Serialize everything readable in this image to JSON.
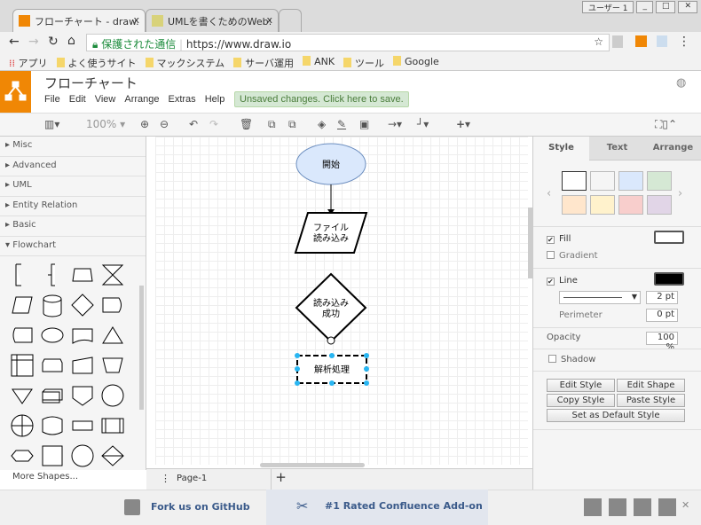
{
  "browser": {
    "tabs": [
      {
        "label": "フローチャート - draw.",
        "close": "x"
      },
      {
        "label": "UMLを書くためのWeb:",
        "close": "x"
      }
    ],
    "user_button": "ユーザー 1",
    "secure_label": "保護された通信",
    "url": "https://www.draw.io",
    "bookmarks": [
      "アプリ",
      "よく使うサイト",
      "マックシステム",
      "サーバ運用",
      "ANK",
      "ツール",
      "Google"
    ]
  },
  "app": {
    "title": "フローチャート",
    "menu": [
      "File",
      "Edit",
      "View",
      "Arrange",
      "Extras",
      "Help"
    ],
    "unsaved": "Unsaved changes. Click here to save.",
    "zoom": "100%"
  },
  "sidebar": {
    "sections": [
      "Misc",
      "Advanced",
      "UML",
      "Entity Relation",
      "Basic",
      "Flowchart"
    ],
    "more_shapes": "More Shapes..."
  },
  "canvas": {
    "nodes": [
      "開始",
      "ファイル\n読み込み",
      "読み込み\n成功",
      "解析処理"
    ]
  },
  "page_tab": "Page-1",
  "panel": {
    "tabs": [
      "Style",
      "Text",
      "Arrange"
    ],
    "swatches": [
      "#ffffff",
      "#f5f5f5",
      "#dae8fc",
      "#d5e8d4",
      "#ffe6cc",
      "#fff2cc",
      "#f8cecc",
      "#e1d5e7"
    ],
    "fill": "Fill",
    "fill_color": "#ffffff",
    "gradient": "Gradient",
    "line": "Line",
    "line_color": "#000000",
    "line_width": "2 pt",
    "perimeter": "Perimeter",
    "perimeter_value": "0 pt",
    "opacity": "Opacity",
    "opacity_value": "100 %",
    "shadow": "Shadow",
    "buttons": [
      "Edit Style",
      "Edit Shape",
      "Copy Style",
      "Paste Style",
      "Set as Default Style"
    ]
  },
  "footer": {
    "github": "Fork us on GitHub",
    "confluence": "#1 Rated Confluence Add-on"
  }
}
